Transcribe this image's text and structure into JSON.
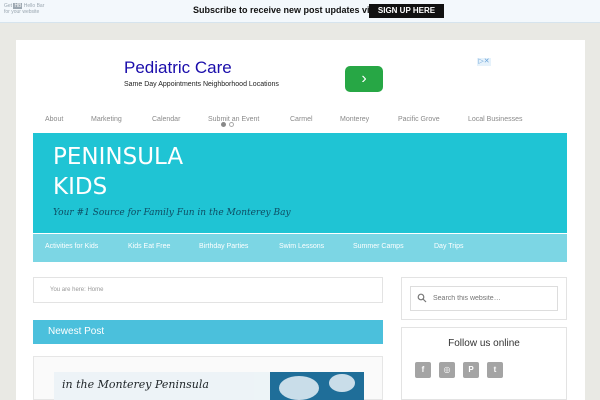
{
  "hellobar": {
    "get_label": "Get",
    "logo_label": "HB",
    "hb_label": "Hello Bar",
    "for_label": "for your website",
    "message": "Subscribe to receive new post updates via email!",
    "button_label": "SIGN UP HERE"
  },
  "ad": {
    "title": "Pediatric Care",
    "subtitle": "Same Day Appointments Neighborhood Locations",
    "go_glyph": "›",
    "choices_glyph": "▷✕"
  },
  "top_nav": [
    "About",
    "Marketing",
    "Calendar",
    "Submit an Event",
    "Carmel",
    "Monterey",
    "Pacific Grove",
    "Local Businesses"
  ],
  "header": {
    "title_line1": "PENINSULA",
    "title_line2": "KIDS",
    "tagline": "Your #1 Source for Family Fun in the Monterey Bay",
    "color": "#1fc4d4"
  },
  "sub_nav": [
    "Activities for Kids",
    "Kids Eat Free",
    "Birthday Parties",
    "Swim Lessons",
    "Summer Camps",
    "Day Trips"
  ],
  "breadcrumb": "You are here: Home",
  "newest": {
    "label": "Newest Post",
    "caption": "in the Monterey Peninsula"
  },
  "search": {
    "placeholder": "Search this website…"
  },
  "follow": {
    "title": "Follow us online",
    "icons": [
      "facebook-icon",
      "instagram-icon",
      "pinterest-icon",
      "twitter-icon"
    ],
    "glyphs": [
      "f",
      "◎",
      "P",
      "t"
    ]
  }
}
